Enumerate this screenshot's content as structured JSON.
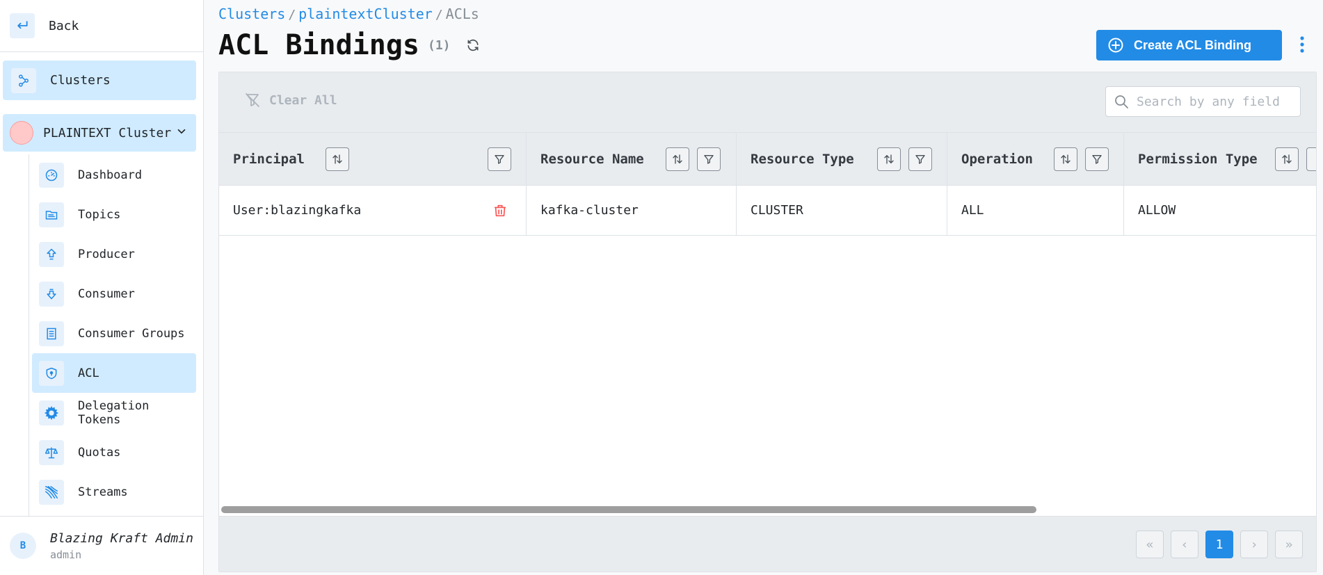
{
  "sidebar": {
    "back_label": "Back",
    "clusters_label": "Clusters",
    "cluster_name": "PLAINTEXT Cluster",
    "items": [
      {
        "label": "Dashboard",
        "icon": "dashboard-icon"
      },
      {
        "label": "Topics",
        "icon": "topics-icon"
      },
      {
        "label": "Producer",
        "icon": "producer-icon"
      },
      {
        "label": "Consumer",
        "icon": "consumer-icon"
      },
      {
        "label": "Consumer Groups",
        "icon": "consumer-groups-icon"
      },
      {
        "label": "ACL",
        "icon": "shield-icon",
        "active": true
      },
      {
        "label": "Delegation Tokens",
        "icon": "delegation-tokens-icon"
      },
      {
        "label": "Quotas",
        "icon": "scale-icon"
      },
      {
        "label": "Streams",
        "icon": "streams-icon"
      }
    ],
    "user": {
      "initial": "B",
      "name": "Blazing Kraft Admin",
      "role": "admin"
    }
  },
  "breadcrumb": {
    "items": [
      "Clusters",
      "plaintextCluster"
    ],
    "current": "ACLs",
    "separator": "/"
  },
  "page": {
    "title": "ACL Bindings",
    "count": "(1)"
  },
  "actions": {
    "create_label": "Create ACL Binding"
  },
  "table": {
    "clear_all_label": "Clear All",
    "search_placeholder": "Search by any field",
    "columns": [
      "Principal",
      "Resource Name",
      "Resource Type",
      "Operation",
      "Permission Type"
    ],
    "rows": [
      [
        "User:blazingkafka",
        "kafka-cluster",
        "CLUSTER",
        "ALL",
        "ALLOW"
      ]
    ]
  },
  "pagination": {
    "current_page": "1",
    "first": "«",
    "prev": "‹",
    "next": "›",
    "last": "»"
  },
  "colors": {
    "accent": "#228be6",
    "active_bg": "#d0ebff",
    "danger": "#fa5252"
  }
}
